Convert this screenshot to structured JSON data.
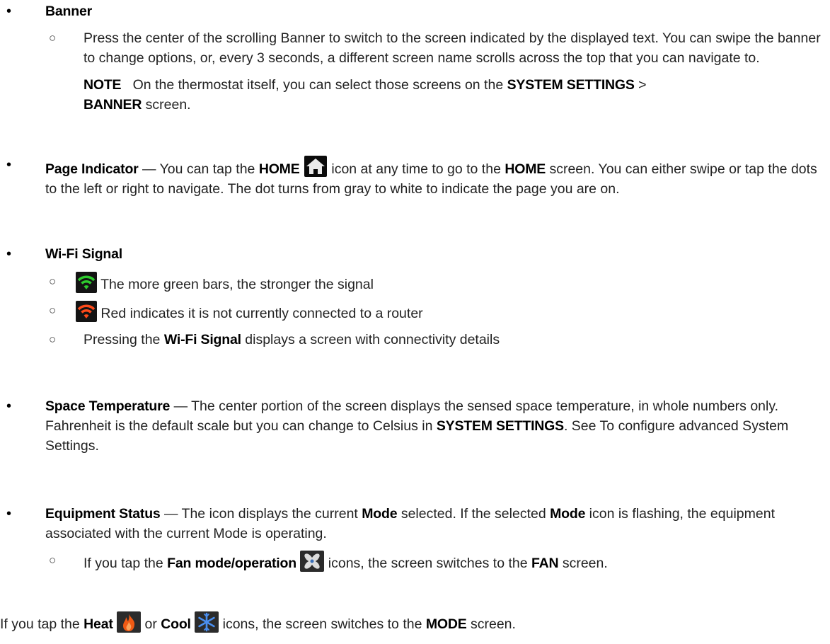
{
  "bullets": {
    "disc": "•",
    "circle": "○"
  },
  "banner": {
    "heading": "Banner",
    "desc": "Press the center of the scrolling Banner to switch to the screen indicated by the displayed text. You can swipe the banner to change options, or, every 3 seconds, a different screen name scrolls across the top that you can navigate to.",
    "note_label": "NOTE",
    "note_text_1": "On the thermostat itself, you can select those screens on the",
    "note_bold_1": "SYSTEM SETTINGS",
    "note_sep": ">",
    "note_bold_2": "BANNER",
    "note_text_2": "screen."
  },
  "page_indicator": {
    "heading": "Page Indicator",
    "text_1": "— You can tap the",
    "bold_1": "HOME",
    "text_2": "icon at any time to go to the",
    "bold_2": "HOME",
    "text_3": "screen. You can either swipe or tap the dots to the left or right to navigate. The dot turns from gray to white to indicate the page you are on."
  },
  "wifi": {
    "heading": "Wi-Fi Signal",
    "green_text": "The more green bars, the stronger the signal",
    "red_text": "Red indicates it is not currently connected to a router",
    "press_text_1": "Pressing the",
    "press_bold": "Wi-Fi Signal",
    "press_text_2": "displays a screen with connectivity details"
  },
  "space_temp": {
    "heading": "Space Temperature",
    "text_1": "— The center portion of the screen displays the sensed space temperature, in whole numbers only. Fahrenheit is the default scale but you can change to Celsius in",
    "bold_1": "SYSTEM SETTINGS",
    "text_2": ". See To configure advanced System Settings."
  },
  "equipment": {
    "heading": "Equipment Status",
    "text_1": "— The icon displays the current",
    "bold_1": "Mode",
    "text_2": "selected. If the selected",
    "bold_2": "Mode",
    "text_3": "icon is flashing, the equipment associated with the current Mode is operating.",
    "fan_text_1": "If you tap the",
    "fan_bold": "Fan mode/operation",
    "fan_text_2": "icons, the screen switches to the",
    "fan_bold_2": "FAN",
    "fan_text_3": "screen."
  },
  "final": {
    "text_1": "If you tap the",
    "bold_heat": "Heat",
    "text_2": "or",
    "bold_cool": "Cool",
    "text_3": "icons, the screen switches to the",
    "bold_mode": "MODE",
    "text_4": "screen."
  },
  "colors": {
    "text": "#222222",
    "wifi_green": "#2ecc2e",
    "wifi_red": "#ff4a1a",
    "flame": "#f05a14",
    "snowflake": "#3a7fe0"
  }
}
